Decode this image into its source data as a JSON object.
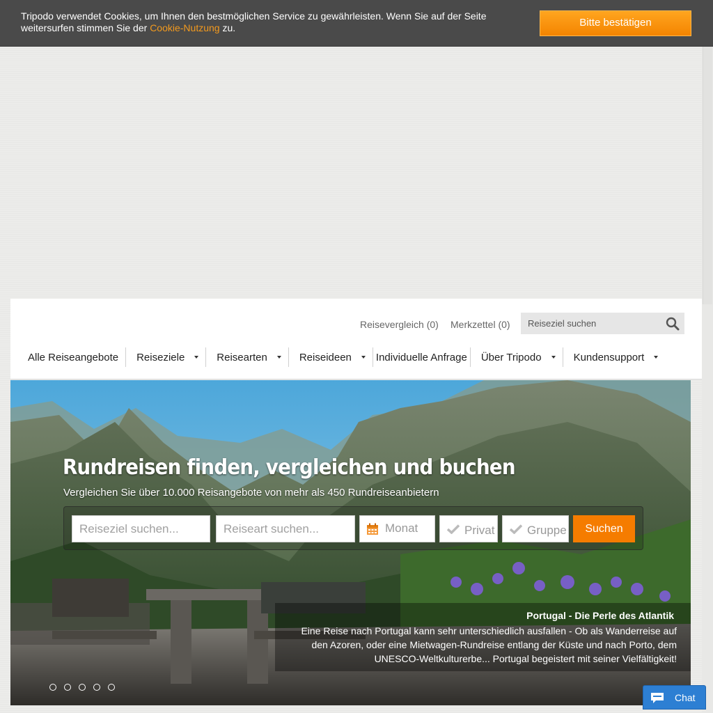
{
  "cookie": {
    "text_before": "Tripodo verwendet Cookies, um Ihnen den bestmöglichen Service zu gewährleisten. Wenn Sie auf der Seite weitersurfen stimmen Sie der ",
    "link": "Cookie-Nutzung",
    "text_after": " zu.",
    "button": "Bitte bestätigen"
  },
  "header": {
    "compare_link": "Reisevergleich (0)",
    "wishlist_link": "Merkzettel (0)",
    "search_placeholder": "Reiseziel suchen",
    "nav": [
      {
        "label": "Alle Reiseangebote",
        "dropdown": false
      },
      {
        "label": "Reiseziele",
        "dropdown": true
      },
      {
        "label": "Reisearten",
        "dropdown": true
      },
      {
        "label": "Reiseideen",
        "dropdown": true
      },
      {
        "label": "Individuelle Anfrage",
        "dropdown": false
      },
      {
        "label": "Über Tripodo",
        "dropdown": true
      },
      {
        "label": "Kundensupport",
        "dropdown": true
      }
    ]
  },
  "hero": {
    "title": "Rundreisen finden, vergleichen und buchen",
    "subtitle": "Vergleichen Sie über 10.000 Reisangebote von mehr als 450 Rundreiseanbietern",
    "destination_placeholder": "Reiseziel suchen...",
    "type_placeholder": "Reiseart suchen...",
    "month_label": "Monat",
    "private_label": "Privat",
    "group_label": "Gruppe",
    "submit_label": "Suchen",
    "caption_title": "Portugal - Die Perle des Atlantik",
    "caption_text": "Eine Reise nach Portugal kann sehr unterschiedlich ausfallen - Ob als Wanderreise auf den Azoren, oder eine Mietwagen-Rundreise entlang der Küste und nach Porto, dem UNESCO-Weltkulturerbe... Portugal begeistert mit seiner Vielfältigkeit!",
    "slide_count": 5
  },
  "chat": {
    "label": "Chat"
  },
  "colors": {
    "accent": "#f57c00",
    "cookie_bg": "#4a4a4a",
    "link_orange": "#f39a1e",
    "chat_blue": "#2d7fd3"
  }
}
